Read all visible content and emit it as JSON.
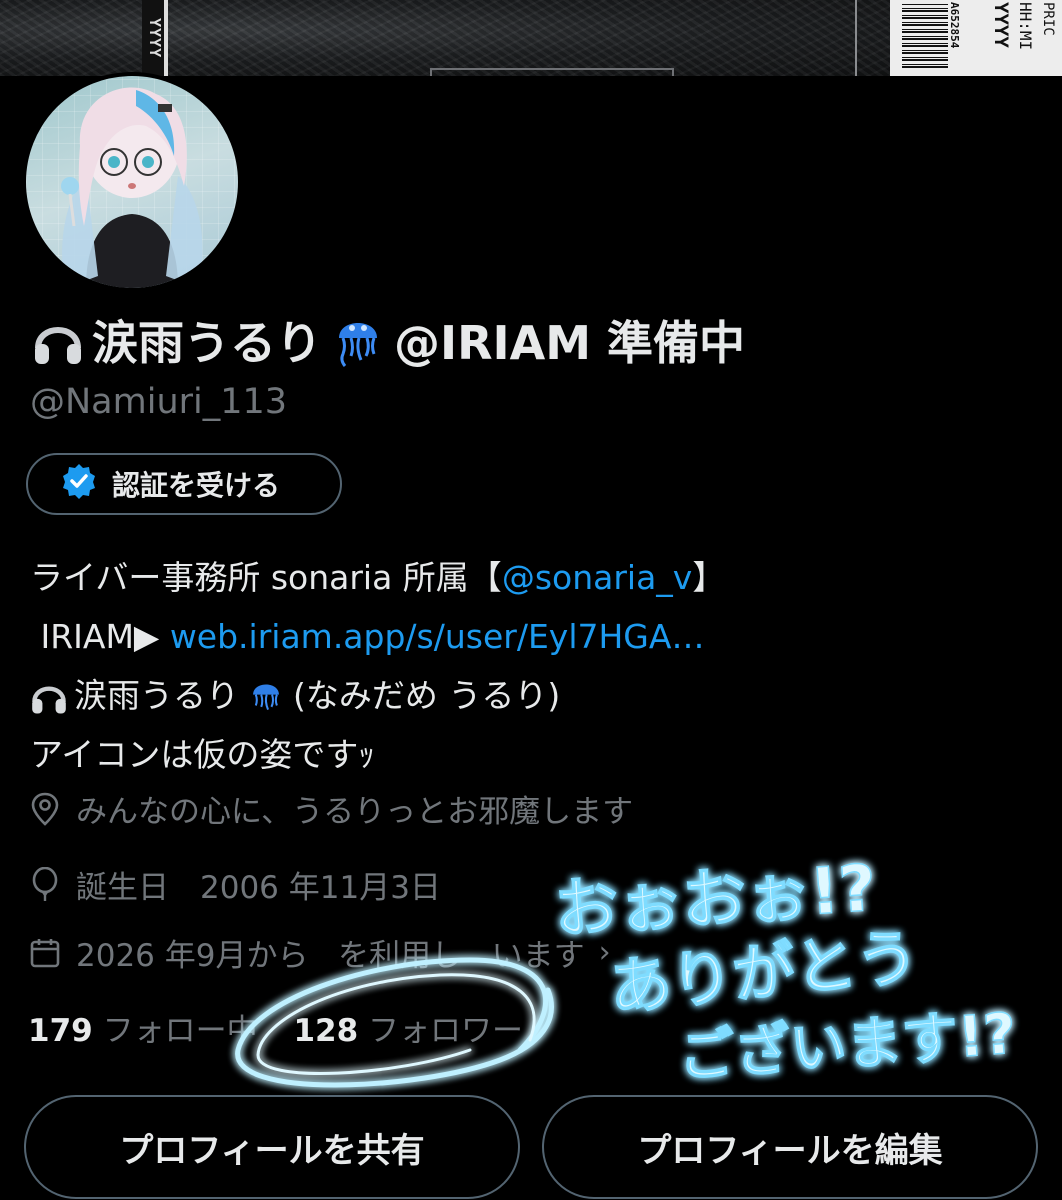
{
  "profile": {
    "display_name_text": "涙雨うるり",
    "display_name_suffix": "@IRIAM 準備中",
    "handle": "@Namiuri_113",
    "verify_label": "認証を受ける",
    "icons": [
      "headphones-icon",
      "jellyfish-icon",
      "verified-badge-icon"
    ]
  },
  "bio": {
    "line1_prefix": "ライバー事務所 sonaria 所属【",
    "line1_link": "@sonaria_v",
    "line1_suffix": "】",
    "line2_prefix": " IRIAM▶ ",
    "line2_link": "web.iriam.app/s/user/Eyl7HGA…",
    "line3_name": "涙雨うるり",
    "line3_reading": "(なみだめ うるり)",
    "line4": "アイコンは仮の姿ですｯ"
  },
  "meta": {
    "location": "みんなの心に、うるりっとお邪魔します",
    "birthday": "誕生日　2006 年11月3日",
    "joined": "2026 年9月から   を利用し   います",
    "icons": [
      "location-pin-icon",
      "balloon-icon",
      "calendar-icon"
    ]
  },
  "stats": {
    "following_count": "179",
    "following_label": "フォロー中",
    "followers_count": "128",
    "followers_label": "フォロワー"
  },
  "buttons": {
    "share": "プロフィールを共有",
    "edit": "プロフィールを編集"
  },
  "banner": {
    "vertical_text": "YYYY",
    "label_text_1": "A652854",
    "label_text_2": "YYYY",
    "label_text_3": "HH:MI",
    "label_text_4": "PRIC"
  },
  "annotation": {
    "line1": "おぉおぉ!?",
    "line2": "ありがとう",
    "line3": "ございます!?",
    "glow_color": "#7fdcff"
  },
  "colors": {
    "background": "#000000",
    "text": "#e7e9ea",
    "muted": "#71767b",
    "link": "#1d9bf0",
    "border": "#536471"
  }
}
